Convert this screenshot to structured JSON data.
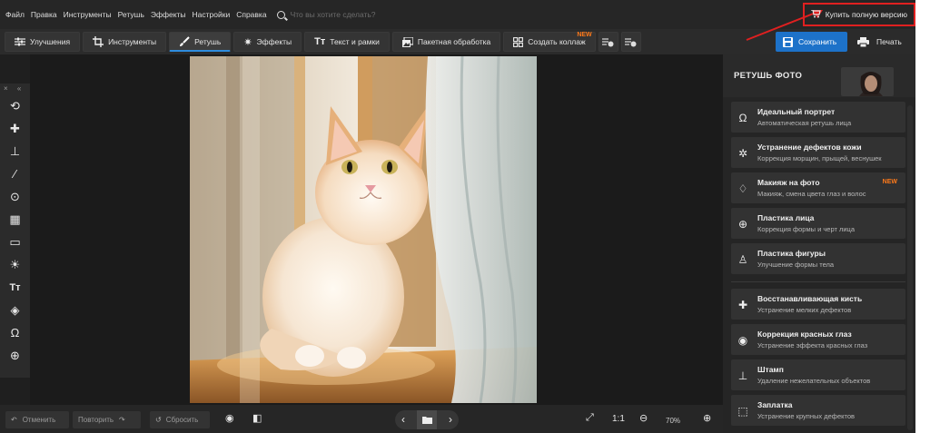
{
  "menu": {
    "items": [
      "Файл",
      "Правка",
      "Инструменты",
      "Ретушь",
      "Эффекты",
      "Настройки",
      "Справка"
    ],
    "search_placeholder": "Что вы хотите сделать?",
    "buy_label": "Купить полную версию"
  },
  "toolbar": {
    "tabs": [
      {
        "label": "Улучшения",
        "icon": "sliders-icon"
      },
      {
        "label": "Инструменты",
        "icon": "crop-icon"
      },
      {
        "label": "Ретушь",
        "icon": "brush-icon",
        "active": true
      },
      {
        "label": "Эффекты",
        "icon": "sparkle-icon"
      },
      {
        "label": "Текст и рамки",
        "icon": "text-icon"
      }
    ],
    "batch_label": "Пакетная обработка",
    "collage_label": "Создать коллаж",
    "collage_badge": "NEW",
    "save_label": "Сохранить",
    "print_label": "Печать"
  },
  "tools_panel": {
    "header": "× «",
    "tools": [
      "rotate-icon",
      "healing-patch-icon",
      "stamp-icon",
      "brush-icon",
      "radial-icon",
      "gradient-icon",
      "vignette-icon",
      "light-icon",
      "text-icon",
      "fill-icon",
      "portrait-icon",
      "face-plastic-icon"
    ]
  },
  "panel": {
    "title": "РЕТУШЬ ФОТО",
    "cards": [
      {
        "title": "Идеальный портрет",
        "subtitle": "Автоматическая ретушь лица",
        "icon": "portrait-icon"
      },
      {
        "title": "Устранение дефектов кожи",
        "subtitle": "Коррекция морщин, прыщей, веснушек",
        "icon": "skin-icon"
      },
      {
        "title": "Макияж на фото",
        "subtitle": "Макияж, смена цвета глаз и волос",
        "icon": "makeup-icon",
        "badge": "NEW"
      },
      {
        "title": "Пластика лица",
        "subtitle": "Коррекция формы и черт лица",
        "icon": "face-icon"
      },
      {
        "title": "Пластика фигуры",
        "subtitle": "Улучшение формы тела",
        "icon": "figure-icon"
      },
      {
        "title": "Восстанавливающая кисть",
        "subtitle": "Устранение мелких дефектов",
        "icon": "healing-icon"
      },
      {
        "title": "Коррекция красных глаз",
        "subtitle": "Устранение эффекта красных глаз",
        "icon": "eye-icon"
      },
      {
        "title": "Штамп",
        "subtitle": "Удаление нежелательных объектов",
        "icon": "stamp-icon"
      },
      {
        "title": "Заплатка",
        "subtitle": "Устранение крупных дефектов",
        "icon": "patch-icon"
      }
    ]
  },
  "bottombar": {
    "undo_label": "Отменить",
    "redo_label": "Повторить",
    "reset_label": "Сбросить",
    "ratio_label": "1:1",
    "zoom": "70%"
  },
  "colors": {
    "accent": "#1d72c9",
    "new_badge": "#ff7a1a",
    "annotation": "#e02020"
  }
}
